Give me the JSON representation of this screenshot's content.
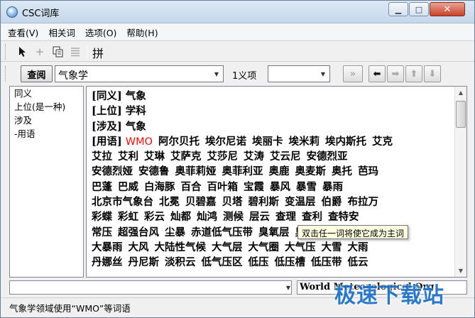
{
  "window": {
    "title": "CSC词库"
  },
  "menu": [
    {
      "label": "查看(V)"
    },
    {
      "label": "相关词"
    },
    {
      "label": "选项(O)"
    },
    {
      "label": "帮助(H)"
    }
  ],
  "toolbar": {
    "pin_label": "拼"
  },
  "search": {
    "lookup_label": "查阅",
    "query": "气象学",
    "sense_label": "1义项",
    "sense_value": ""
  },
  "relations": [
    {
      "label": "同义"
    },
    {
      "label": "上位(是一种)"
    },
    {
      "label": "涉及"
    },
    {
      "label": "-用语"
    }
  ],
  "content": {
    "synonym": {
      "tag": "[同义]",
      "text": "气象"
    },
    "hypernym": {
      "tag": "[上位]",
      "text": "学科"
    },
    "related": {
      "tag": "[涉及]",
      "text": "气象"
    },
    "terms_tag": "[用语]",
    "terms_first": "WMO",
    "term_lines": [
      [
        "阿尔贝托",
        "埃尔尼诺",
        "埃丽卡",
        "埃米莉",
        "埃内斯托",
        "艾克"
      ],
      [
        "艾拉",
        "艾利",
        "艾琳",
        "艾萨克",
        "艾莎尼",
        "艾涛",
        "艾云尼",
        "安德烈亚"
      ],
      [
        "安德烈娅",
        "安德鲁",
        "奥菲莉娅",
        "奥菲利亚",
        "奥鹿",
        "奥麦斯",
        "奥托",
        "芭玛"
      ],
      [
        "巴蓬",
        "巴威",
        "白海豚",
        "百合",
        "百叶箱",
        "宝霞",
        "暴风",
        "暴雪",
        "暴雨"
      ],
      [
        "北京市气象台",
        "北冕",
        "贝碧嘉",
        "贝塔",
        "碧利斯",
        "变温层",
        "伯爵",
        "布拉万"
      ],
      [
        "彩蝶",
        "彩虹",
        "彩云",
        "灿都",
        "灿鸿",
        "测候",
        "层云",
        "查理",
        "查利",
        "查特安"
      ],
      [
        "常压",
        "超强台风",
        "尘暴",
        "赤道低气压带",
        "臭氧层",
        "臭氧层空洞",
        "臭氧洞"
      ],
      [
        "大暴雨",
        "大风",
        "大陆性气候",
        "大气层",
        "大气圈",
        "大气压",
        "大雪",
        "大雨"
      ],
      [
        "丹娜丝",
        "丹尼斯",
        "淡积云",
        "低气压区",
        "低压",
        "低压槽",
        "低压带",
        "低云"
      ]
    ]
  },
  "tooltip": "双击任一词将使它成为主词",
  "bottom": {
    "field_value": "",
    "combo_value": "World Meteorological Org"
  },
  "status": {
    "text": "气象学领域使用“WMO”等词语"
  },
  "watermark": "极速下载站"
}
